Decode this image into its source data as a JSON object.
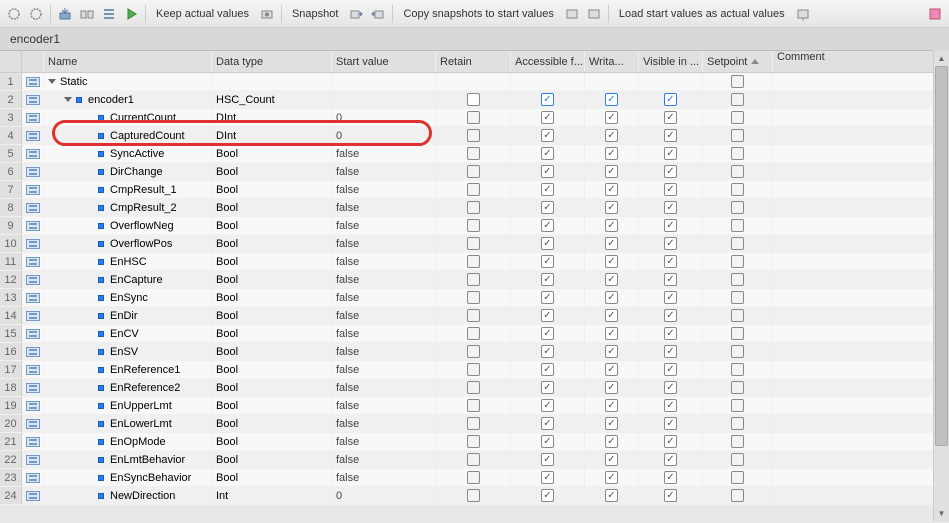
{
  "toolbar": {
    "keep_values": "Keep actual values",
    "snapshot": "Snapshot",
    "copy_snapshots": "Copy snapshots to start values",
    "load_start": "Load start values as actual values"
  },
  "title": "encoder1",
  "columns": {
    "name": "Name",
    "type": "Data type",
    "start": "Start value",
    "retain": "Retain",
    "accessible": "Accessible f...",
    "writable": "Writa...",
    "visible": "Visible in ...",
    "setpoint": "Setpoint",
    "comment": "Comment"
  },
  "rows": [
    {
      "n": "1",
      "name": "Static",
      "type": "",
      "start": "",
      "indent": 0,
      "expand": true,
      "retain": null,
      "acc": null,
      "wri": null,
      "vis": null,
      "set": "grey",
      "icon": "var"
    },
    {
      "n": "2",
      "name": "encoder1",
      "type": "HSC_Count",
      "start": "",
      "indent": 1,
      "expand": true,
      "retain": "off",
      "acc": "blue",
      "wri": "blue",
      "vis": "blue",
      "set": "grey",
      "icon": "var"
    },
    {
      "n": "3",
      "name": "CurrentCount",
      "type": "DInt",
      "start": "0",
      "indent": 2,
      "retain": "grey",
      "acc": "on",
      "wri": "on",
      "vis": "on",
      "set": "grey",
      "icon": "var"
    },
    {
      "n": "4",
      "name": "CapturedCount",
      "type": "DInt",
      "start": "0",
      "indent": 2,
      "retain": "grey",
      "acc": "on",
      "wri": "on",
      "vis": "on",
      "set": "grey",
      "icon": "var"
    },
    {
      "n": "5",
      "name": "SyncActive",
      "type": "Bool",
      "start": "false",
      "indent": 2,
      "retain": "grey",
      "acc": "on",
      "wri": "on",
      "vis": "on",
      "set": "grey",
      "icon": "var"
    },
    {
      "n": "6",
      "name": "DirChange",
      "type": "Bool",
      "start": "false",
      "indent": 2,
      "retain": "grey",
      "acc": "on",
      "wri": "on",
      "vis": "on",
      "set": "grey",
      "icon": "var"
    },
    {
      "n": "7",
      "name": "CmpResult_1",
      "type": "Bool",
      "start": "false",
      "indent": 2,
      "retain": "grey",
      "acc": "on",
      "wri": "on",
      "vis": "on",
      "set": "grey",
      "icon": "var"
    },
    {
      "n": "8",
      "name": "CmpResult_2",
      "type": "Bool",
      "start": "false",
      "indent": 2,
      "retain": "grey",
      "acc": "on",
      "wri": "on",
      "vis": "on",
      "set": "grey",
      "icon": "var"
    },
    {
      "n": "9",
      "name": "OverflowNeg",
      "type": "Bool",
      "start": "false",
      "indent": 2,
      "retain": "grey",
      "acc": "on",
      "wri": "on",
      "vis": "on",
      "set": "grey",
      "icon": "var"
    },
    {
      "n": "10",
      "name": "OverflowPos",
      "type": "Bool",
      "start": "false",
      "indent": 2,
      "retain": "grey",
      "acc": "on",
      "wri": "on",
      "vis": "on",
      "set": "grey",
      "icon": "var"
    },
    {
      "n": "11",
      "name": "EnHSC",
      "type": "Bool",
      "start": "false",
      "indent": 2,
      "retain": "grey",
      "acc": "on",
      "wri": "on",
      "vis": "on",
      "set": "grey",
      "icon": "var"
    },
    {
      "n": "12",
      "name": "EnCapture",
      "type": "Bool",
      "start": "false",
      "indent": 2,
      "retain": "grey",
      "acc": "on",
      "wri": "on",
      "vis": "on",
      "set": "grey",
      "icon": "var"
    },
    {
      "n": "13",
      "name": "EnSync",
      "type": "Bool",
      "start": "false",
      "indent": 2,
      "retain": "grey",
      "acc": "on",
      "wri": "on",
      "vis": "on",
      "set": "grey",
      "icon": "var"
    },
    {
      "n": "14",
      "name": "EnDir",
      "type": "Bool",
      "start": "false",
      "indent": 2,
      "retain": "grey",
      "acc": "on",
      "wri": "on",
      "vis": "on",
      "set": "grey",
      "icon": "var"
    },
    {
      "n": "15",
      "name": "EnCV",
      "type": "Bool",
      "start": "false",
      "indent": 2,
      "retain": "grey",
      "acc": "on",
      "wri": "on",
      "vis": "on",
      "set": "grey",
      "icon": "var"
    },
    {
      "n": "16",
      "name": "EnSV",
      "type": "Bool",
      "start": "false",
      "indent": 2,
      "retain": "grey",
      "acc": "on",
      "wri": "on",
      "vis": "on",
      "set": "grey",
      "icon": "var"
    },
    {
      "n": "17",
      "name": "EnReference1",
      "type": "Bool",
      "start": "false",
      "indent": 2,
      "retain": "grey",
      "acc": "on",
      "wri": "on",
      "vis": "on",
      "set": "grey",
      "icon": "var"
    },
    {
      "n": "18",
      "name": "EnReference2",
      "type": "Bool",
      "start": "false",
      "indent": 2,
      "retain": "grey",
      "acc": "on",
      "wri": "on",
      "vis": "on",
      "set": "grey",
      "icon": "var"
    },
    {
      "n": "19",
      "name": "EnUpperLmt",
      "type": "Bool",
      "start": "false",
      "indent": 2,
      "retain": "grey",
      "acc": "on",
      "wri": "on",
      "vis": "on",
      "set": "grey",
      "icon": "var"
    },
    {
      "n": "20",
      "name": "EnLowerLmt",
      "type": "Bool",
      "start": "false",
      "indent": 2,
      "retain": "grey",
      "acc": "on",
      "wri": "on",
      "vis": "on",
      "set": "grey",
      "icon": "var"
    },
    {
      "n": "21",
      "name": "EnOpMode",
      "type": "Bool",
      "start": "false",
      "indent": 2,
      "retain": "grey",
      "acc": "on",
      "wri": "on",
      "vis": "on",
      "set": "grey",
      "icon": "var"
    },
    {
      "n": "22",
      "name": "EnLmtBehavior",
      "type": "Bool",
      "start": "false",
      "indent": 2,
      "retain": "grey",
      "acc": "on",
      "wri": "on",
      "vis": "on",
      "set": "grey",
      "icon": "var"
    },
    {
      "n": "23",
      "name": "EnSyncBehavior",
      "type": "Bool",
      "start": "false",
      "indent": 2,
      "retain": "grey",
      "acc": "on",
      "wri": "on",
      "vis": "on",
      "set": "grey",
      "icon": "var"
    },
    {
      "n": "24",
      "name": "NewDirection",
      "type": "Int",
      "start": "0",
      "indent": 2,
      "retain": "grey",
      "acc": "on",
      "wri": "on",
      "vis": "on",
      "set": "grey",
      "icon": "var"
    }
  ]
}
